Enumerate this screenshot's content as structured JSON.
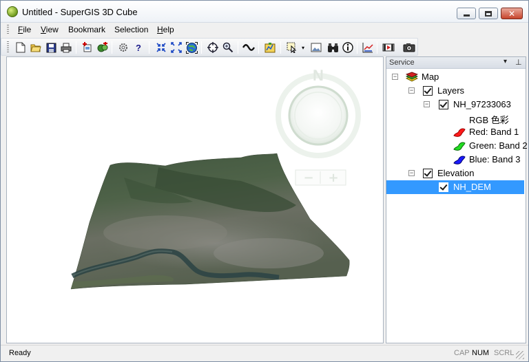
{
  "window": {
    "title": "Untitled - SuperGIS 3D Cube",
    "minimize_label": "",
    "maximize_label": "",
    "close_label": "✕"
  },
  "menu": [
    {
      "label": "File",
      "hotkey": "F",
      "rest": "ile"
    },
    {
      "label": "View",
      "hotkey": "V",
      "rest": "iew"
    },
    {
      "label": "Bookmark",
      "hotkey": "",
      "rest": "Bookmark"
    },
    {
      "label": "Selection",
      "hotkey": "",
      "rest": "Selection"
    },
    {
      "label": "Help",
      "hotkey": "H",
      "rest": "elp"
    }
  ],
  "toolbar": {
    "icons": [
      "new-file",
      "open-folder",
      "save",
      "print",
      "add-layer",
      "add-data",
      "settings",
      "help",
      "zoom-in-fixed",
      "zoom-out-fixed",
      "full-extent",
      "pan",
      "zoom-tool",
      "fly",
      "map-tips",
      "select",
      "dropdown",
      "image",
      "find",
      "identify",
      "measure",
      "record",
      "screenshot"
    ]
  },
  "compass": {
    "north_label": "N",
    "zoom_out_label": "−",
    "zoom_in_label": "+"
  },
  "panel": {
    "title": "Service",
    "dropdown_icon": "▾",
    "pin_icon": "⊥",
    "tree": {
      "map": "Map",
      "layers": "Layers",
      "raster": "NH_97233063",
      "rgb": "RGB 色彩",
      "red": "Red: Band 1",
      "green": "Green: Band 2",
      "blue": "Blue: Band 3",
      "elevation": "Elevation",
      "dem": "NH_DEM"
    },
    "colors": {
      "red": "#ff1a1a",
      "green": "#22dd22",
      "blue": "#1a1aff",
      "selection": "#3399ff"
    }
  },
  "status": {
    "text": "Ready",
    "cap": "CAP",
    "num": "NUM",
    "scrl": "SCRL"
  }
}
